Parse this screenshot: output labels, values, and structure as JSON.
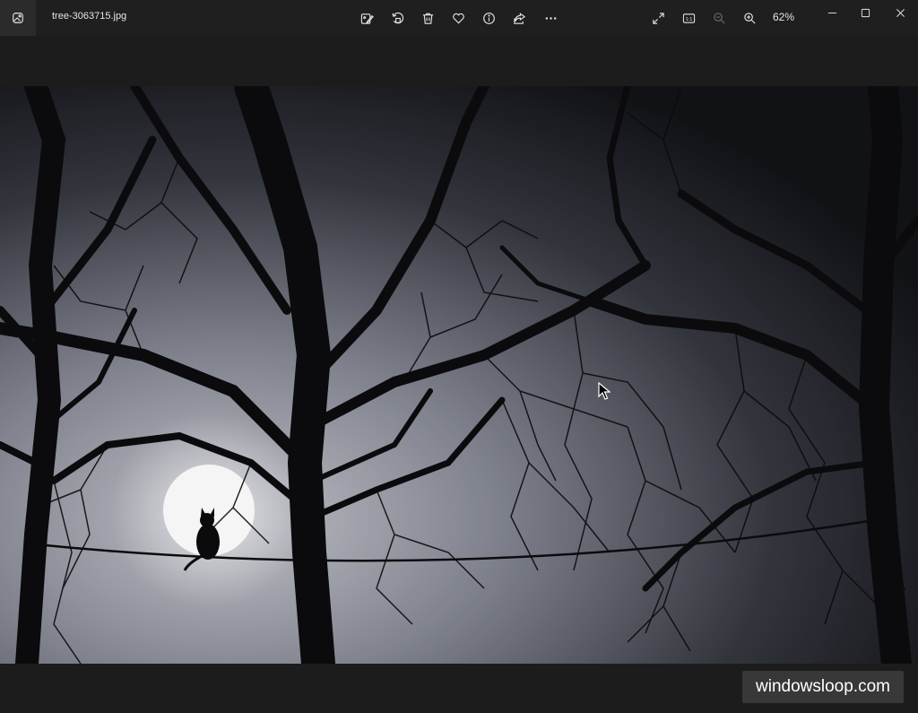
{
  "window": {
    "filename": "tree-3063715.jpg",
    "zoom_level": "62%"
  },
  "toolbar": {
    "edit_icon": "edit-image-icon",
    "rotate_icon": "rotate-icon",
    "delete_icon": "delete-icon",
    "favorite_icon": "heart-icon",
    "info_icon": "info-icon",
    "share_icon": "share-icon",
    "more_icon": "more-icon",
    "fullscreen_icon": "fullscreen-icon",
    "actual_size_label": "1:1",
    "zoom_out_icon": "zoom-out-icon",
    "zoom_in_icon": "zoom-in-icon"
  },
  "watermark": {
    "text": "windowsloop.com"
  },
  "colors": {
    "titlebar_bg": "#1f1f1f",
    "window_bg": "#1c1c1c",
    "icon_color": "#e6e6e6",
    "disabled_icon_color": "#6b6b6b"
  }
}
